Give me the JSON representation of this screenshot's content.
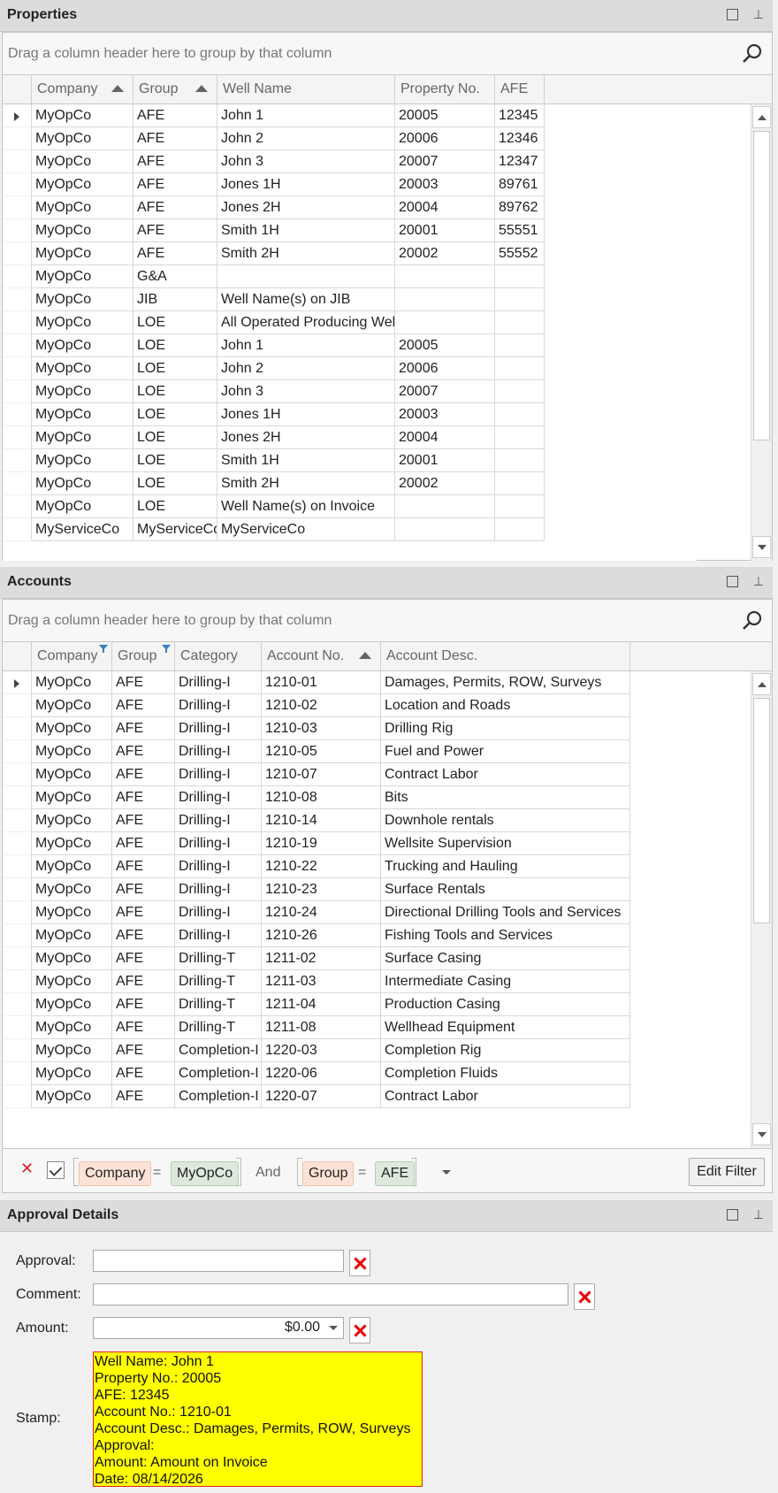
{
  "properties": {
    "title": "Properties",
    "group_panel_text": "Drag a column header here to group by that column",
    "columns": [
      "Company",
      "Group",
      "Well Name",
      "Property No.",
      "AFE"
    ],
    "rows": [
      [
        "MyOpCo",
        "AFE",
        "John 1",
        "20005",
        "12345"
      ],
      [
        "MyOpCo",
        "AFE",
        "John 2",
        "20006",
        "12346"
      ],
      [
        "MyOpCo",
        "AFE",
        "John 3",
        "20007",
        "12347"
      ],
      [
        "MyOpCo",
        "AFE",
        "Jones 1H",
        "20003",
        "89761"
      ],
      [
        "MyOpCo",
        "AFE",
        "Jones 2H",
        "20004",
        "89762"
      ],
      [
        "MyOpCo",
        "AFE",
        "Smith 1H",
        "20001",
        "55551"
      ],
      [
        "MyOpCo",
        "AFE",
        "Smith 2H",
        "20002",
        "55552"
      ],
      [
        "MyOpCo",
        "G&A",
        "",
        "",
        ""
      ],
      [
        "MyOpCo",
        "JIB",
        "Well Name(s) on JIB",
        "",
        ""
      ],
      [
        "MyOpCo",
        "LOE",
        "All Operated Producing Wells",
        "",
        ""
      ],
      [
        "MyOpCo",
        "LOE",
        "John 1",
        "20005",
        ""
      ],
      [
        "MyOpCo",
        "LOE",
        "John 2",
        "20006",
        ""
      ],
      [
        "MyOpCo",
        "LOE",
        "John 3",
        "20007",
        ""
      ],
      [
        "MyOpCo",
        "LOE",
        "Jones 1H",
        "20003",
        ""
      ],
      [
        "MyOpCo",
        "LOE",
        "Jones 2H",
        "20004",
        ""
      ],
      [
        "MyOpCo",
        "LOE",
        "Smith 1H",
        "20001",
        ""
      ],
      [
        "MyOpCo",
        "LOE",
        "Smith 2H",
        "20002",
        ""
      ],
      [
        "MyOpCo",
        "LOE",
        "Well Name(s) on Invoice",
        "",
        ""
      ],
      [
        "MyServiceCo",
        "MyServiceCo",
        "MyServiceCo",
        "",
        ""
      ]
    ]
  },
  "accounts": {
    "title": "Accounts",
    "group_panel_text": "Drag a column header here to group by that column",
    "columns": [
      "Company",
      "Group",
      "Category",
      "Account No.",
      "Account Desc."
    ],
    "rows": [
      [
        "MyOpCo",
        "AFE",
        "Drilling-I",
        "1210-01",
        "Damages, Permits, ROW, Surveys"
      ],
      [
        "MyOpCo",
        "AFE",
        "Drilling-I",
        "1210-02",
        "Location and Roads"
      ],
      [
        "MyOpCo",
        "AFE",
        "Drilling-I",
        "1210-03",
        "Drilling Rig"
      ],
      [
        "MyOpCo",
        "AFE",
        "Drilling-I",
        "1210-05",
        "Fuel and Power"
      ],
      [
        "MyOpCo",
        "AFE",
        "Drilling-I",
        "1210-07",
        "Contract Labor"
      ],
      [
        "MyOpCo",
        "AFE",
        "Drilling-I",
        "1210-08",
        "Bits"
      ],
      [
        "MyOpCo",
        "AFE",
        "Drilling-I",
        "1210-14",
        "Downhole rentals"
      ],
      [
        "MyOpCo",
        "AFE",
        "Drilling-I",
        "1210-19",
        "Wellsite Supervision"
      ],
      [
        "MyOpCo",
        "AFE",
        "Drilling-I",
        "1210-22",
        "Trucking and Hauling"
      ],
      [
        "MyOpCo",
        "AFE",
        "Drilling-I",
        "1210-23",
        "Surface Rentals"
      ],
      [
        "MyOpCo",
        "AFE",
        "Drilling-I",
        "1210-24",
        "Directional Drilling Tools and Services"
      ],
      [
        "MyOpCo",
        "AFE",
        "Drilling-I",
        "1210-26",
        "Fishing Tools and Services"
      ],
      [
        "MyOpCo",
        "AFE",
        "Drilling-T",
        "1211-02",
        "Surface Casing"
      ],
      [
        "MyOpCo",
        "AFE",
        "Drilling-T",
        "1211-03",
        "Intermediate Casing"
      ],
      [
        "MyOpCo",
        "AFE",
        "Drilling-T",
        "1211-04",
        "Production Casing"
      ],
      [
        "MyOpCo",
        "AFE",
        "Drilling-T",
        "1211-08",
        "Wellhead Equipment"
      ],
      [
        "MyOpCo",
        "AFE",
        "Completion-I",
        "1220-03",
        "Completion Rig"
      ],
      [
        "MyOpCo",
        "AFE",
        "Completion-I",
        "1220-06",
        "Completion Fluids"
      ],
      [
        "MyOpCo",
        "AFE",
        "Completion-I",
        "1220-07",
        "Contract Labor"
      ]
    ],
    "filter": {
      "field1": "Company",
      "op1": "=",
      "value1": "MyOpCo",
      "conj": "And",
      "field2": "Group",
      "op2": "=",
      "value2": "AFE",
      "edit_label": "Edit Filter"
    }
  },
  "approval": {
    "title": "Approval Details",
    "approval_label": "Approval:",
    "approval_value": "",
    "comment_label": "Comment:",
    "comment_value": "",
    "amount_label": "Amount:",
    "amount_value": "$0.00",
    "stamp_label": "Stamp:",
    "stamp_lines": [
      "Well Name: John 1",
      "Property No.: 20005",
      "AFE: 12345",
      "Account No.: 1210-01",
      "Account Desc.: Damages, Permits, ROW, Surveys",
      "Approval:",
      "Amount: Amount on Invoice",
      "Date: 08/14/2026"
    ]
  },
  "colors": {
    "stamp_bg": "#ffff00",
    "stamp_border": "#e02020",
    "clear_x": "#e00000",
    "filter_field_bg": "#fde3d6",
    "filter_value_bg": "#dde9dd"
  },
  "icons": [
    "maximize-icon",
    "pin-icon",
    "search-icon",
    "row-indicator-icon",
    "sort-asc-icon",
    "filter-icon",
    "scroll-up-icon",
    "scroll-down-icon",
    "clear-filter-icon",
    "check-icon",
    "dropdown-icon",
    "clear-x-icon"
  ]
}
